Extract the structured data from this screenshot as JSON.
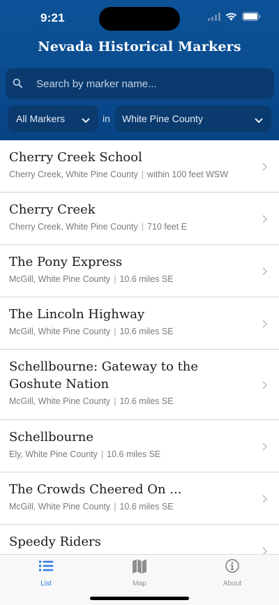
{
  "status_bar": {
    "time": "9:21"
  },
  "app": {
    "title": "Nevada Historical Markers"
  },
  "search": {
    "placeholder": "Search by marker name..."
  },
  "filters": {
    "category": "All Markers",
    "connector": "in",
    "county": "White Pine County"
  },
  "markers": [
    {
      "name": "Cherry Creek School",
      "location": "Cherry Creek, White Pine County",
      "distance": "within 100 feet WSW"
    },
    {
      "name": "Cherry Creek",
      "location": "Cherry Creek, White Pine County",
      "distance": "710 feet E"
    },
    {
      "name": "The Pony Express",
      "location": "McGill, White Pine County",
      "distance": "10.6 miles SE"
    },
    {
      "name": "The Lincoln Highway",
      "location": "McGill, White Pine County",
      "distance": "10.6 miles SE"
    },
    {
      "name": "Schellbourne: Gateway to the Goshute Nation",
      "location": "McGill, White Pine County",
      "distance": "10.6 miles SE"
    },
    {
      "name": "Schellbourne",
      "location": "Ely, White Pine County",
      "distance": "10.6 miles SE"
    },
    {
      "name": "The Crowds Cheered On ...",
      "location": "McGill, White Pine County",
      "distance": "10.6 miles SE"
    },
    {
      "name": "Speedy Riders",
      "location": "",
      "distance": ""
    }
  ],
  "separator": "|",
  "tabs": [
    {
      "label": "List",
      "icon": "list-icon",
      "active": true
    },
    {
      "label": "Map",
      "icon": "map-icon",
      "active": false
    },
    {
      "label": "About",
      "icon": "info-icon",
      "active": false
    }
  ],
  "colors": {
    "header": "#0a4c8f",
    "field": "#0a3a6e",
    "accent": "#2c7be5",
    "inactive": "#8d8d8d"
  }
}
